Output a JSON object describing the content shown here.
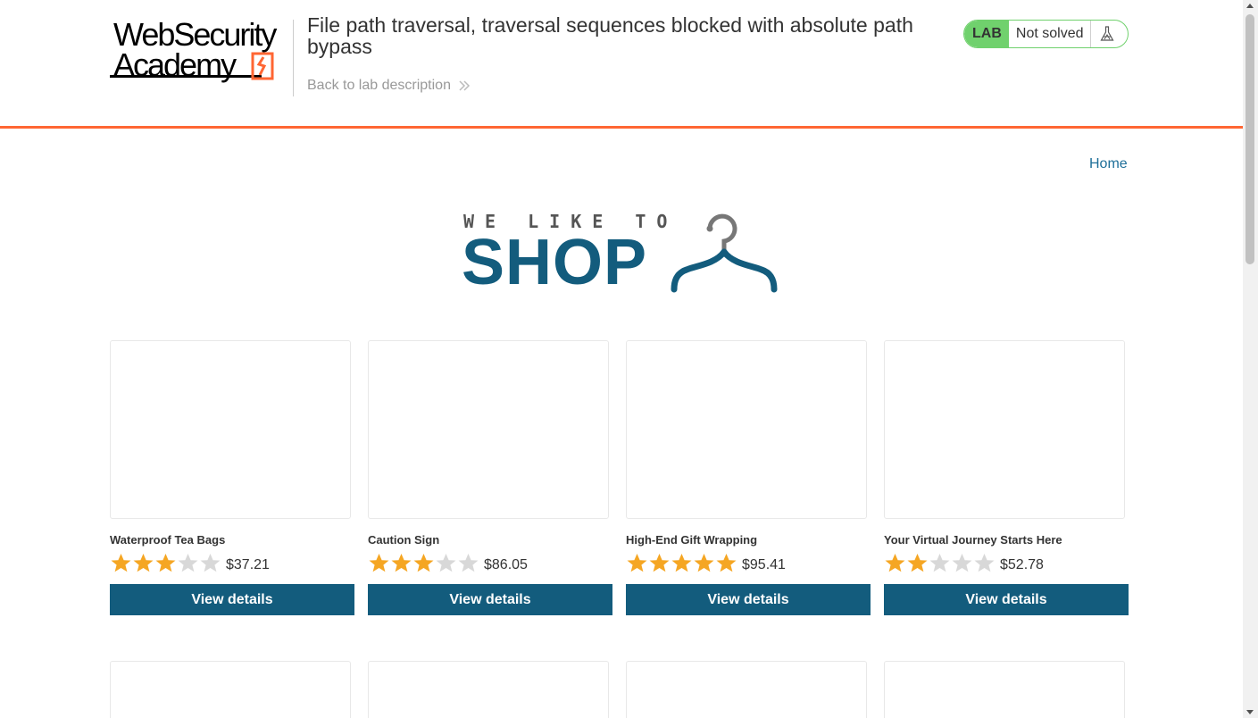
{
  "header": {
    "logo_line1": "WebSecurity",
    "logo_line2": "Academy",
    "lab_title": "File path traversal, traversal sequences blocked with absolute path bypass",
    "back_link": "Back to lab description",
    "lab_badge": "LAB",
    "lab_status": "Not solved",
    "flask_icon": "flask-icon",
    "accent_color": "#ff6633",
    "status_color": "#70d16d"
  },
  "nav": {
    "home": "Home"
  },
  "hero": {
    "small": "WE LIKE TO",
    "big": "SHOP",
    "icon": "hanger-icon",
    "color": "#135c7d"
  },
  "products": [
    {
      "name": "Waterproof Tea Bags",
      "rating": 3,
      "price": "$37.21",
      "button": "View details"
    },
    {
      "name": "Caution Sign",
      "rating": 3,
      "price": "$86.05",
      "button": "View details"
    },
    {
      "name": "High-End Gift Wrapping",
      "rating": 5,
      "price": "$95.41",
      "button": "View details"
    },
    {
      "name": "Your Virtual Journey Starts Here",
      "rating": 2,
      "price": "$52.78",
      "button": "View details"
    }
  ],
  "colors": {
    "button": "#135c7d",
    "star_on": "#f5a623",
    "star_off": "#d8d8d8",
    "link": "#1e6f99"
  }
}
